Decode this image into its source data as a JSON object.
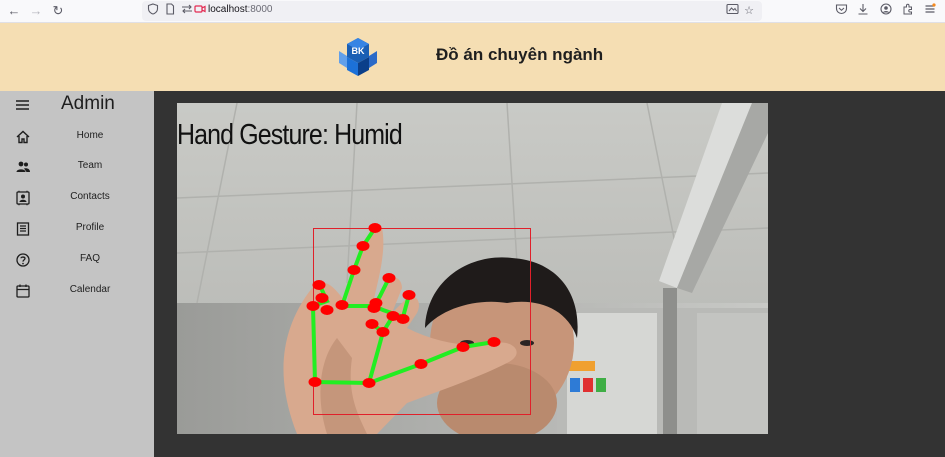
{
  "browser": {
    "url_host": "localhost",
    "url_port": ":8000",
    "icons": [
      "back-icon",
      "forward-icon",
      "reload-icon",
      "shield-icon",
      "page-icon",
      "permissions-icon",
      "camera-icon",
      "reader-icon",
      "bookmark-star-icon",
      "pocket-icon",
      "download-icon",
      "account-icon",
      "extensions-icon",
      "menu-icon"
    ]
  },
  "header": {
    "logo_text": "BK",
    "title": "Đồ án chuyên ngành",
    "background": "#f5deb3"
  },
  "sidebar": {
    "title": "Admin",
    "items": [
      {
        "label": "Home",
        "icon": "home-icon"
      },
      {
        "label": "Team",
        "icon": "team-icon"
      },
      {
        "label": "Contacts",
        "icon": "contacts-icon"
      },
      {
        "label": "Profile",
        "icon": "profile-icon"
      },
      {
        "label": "FAQ",
        "icon": "help-icon"
      },
      {
        "label": "Calendar",
        "icon": "calendar-icon"
      }
    ],
    "background": "#c4c4c4"
  },
  "main": {
    "background": "#333333",
    "video": {
      "gesture_text": "Hand Gesture: Humid",
      "box_color": "#e0202a",
      "landmark_color": "#ff0000",
      "bone_color": "#22ee22"
    }
  }
}
